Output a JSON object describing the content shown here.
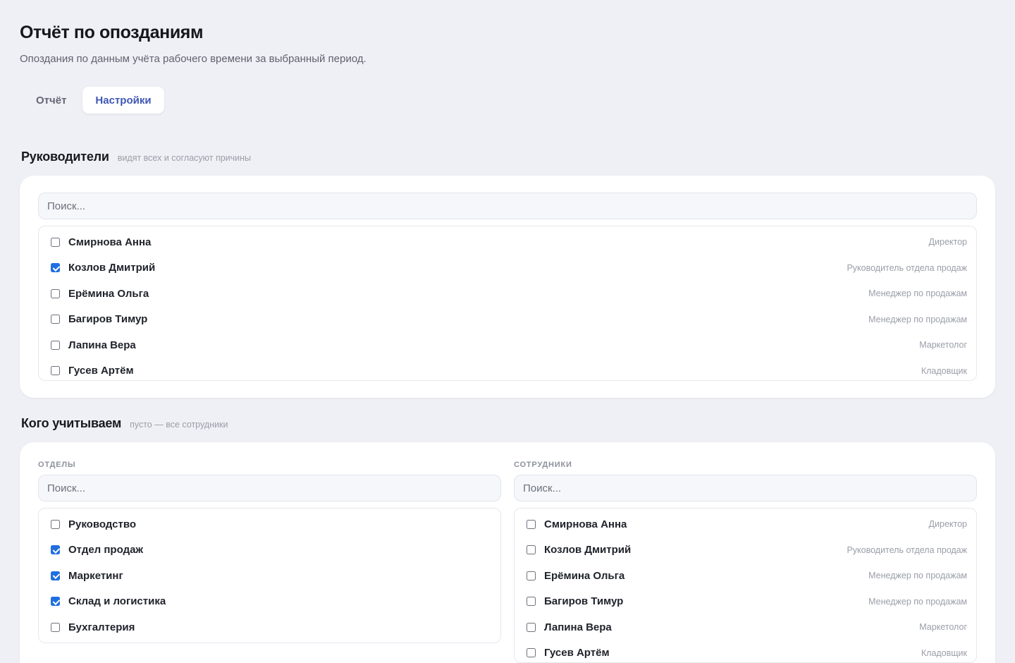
{
  "header": {
    "title": "Отчёт по опозданиям",
    "subtitle": "Опоздания по данным учёта рабочего времени за выбранный период."
  },
  "tabs": [
    {
      "label": "Отчёт",
      "active": false
    },
    {
      "label": "Настройки",
      "active": true
    }
  ],
  "managers": {
    "title": "Руководители",
    "hint": "видят всех и согласуют причины",
    "search_placeholder": "Поиск...",
    "items": [
      {
        "name": "Смирнова Анна",
        "role": "Директор",
        "checked": false
      },
      {
        "name": "Козлов Дмитрий",
        "role": "Руководитель отдела продаж",
        "checked": true
      },
      {
        "name": "Ерёмина Ольга",
        "role": "Менеджер по продажам",
        "checked": false
      },
      {
        "name": "Багиров Тимур",
        "role": "Менеджер по продажам",
        "checked": false
      },
      {
        "name": "Лапина Вера",
        "role": "Маркетолог",
        "checked": false
      },
      {
        "name": "Гусев Артём",
        "role": "Кладовщик",
        "checked": false
      }
    ]
  },
  "scope": {
    "title": "Кого учитываем",
    "hint": "пусто — все сотрудники",
    "departments": {
      "label": "Отделы",
      "search_placeholder": "Поиск...",
      "items": [
        {
          "name": "Руководство",
          "checked": false
        },
        {
          "name": "Отдел продаж",
          "checked": true
        },
        {
          "name": "Маркетинг",
          "checked": true
        },
        {
          "name": "Склад и логистика",
          "checked": true
        },
        {
          "name": "Бухгалтерия",
          "checked": false
        }
      ]
    },
    "employees": {
      "label": "Сотрудники",
      "search_placeholder": "Поиск...",
      "items": [
        {
          "name": "Смирнова Анна",
          "role": "Директор",
          "checked": false
        },
        {
          "name": "Козлов Дмитрий",
          "role": "Руководитель отдела продаж",
          "checked": false
        },
        {
          "name": "Ерёмина Ольга",
          "role": "Менеджер по продажам",
          "checked": false
        },
        {
          "name": "Багиров Тимур",
          "role": "Менеджер по продажам",
          "checked": false
        },
        {
          "name": "Лапина Вера",
          "role": "Маркетолог",
          "checked": false
        },
        {
          "name": "Гусев Артём",
          "role": "Кладовщик",
          "checked": false
        }
      ]
    }
  }
}
